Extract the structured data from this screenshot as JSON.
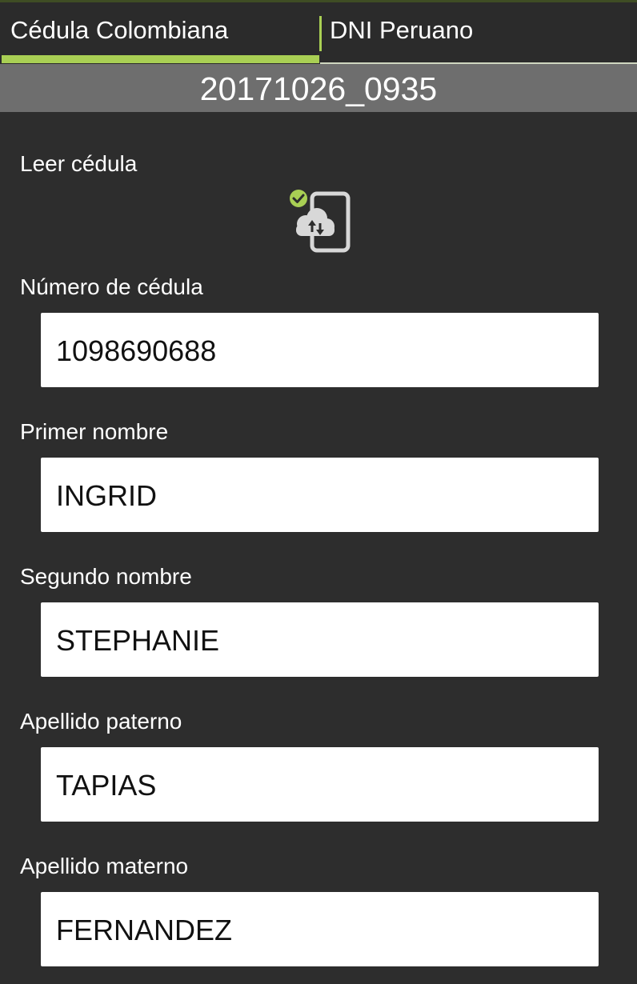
{
  "tabs": [
    {
      "label": "Cédula Colombiana",
      "selected": true
    },
    {
      "label": "DNI Peruano",
      "selected": false
    }
  ],
  "session": {
    "id": "20171026_0935"
  },
  "read": {
    "label": "Leer cédula",
    "icon": "phone-cloud-sync-icon",
    "status_icon": "check-circle-icon"
  },
  "fields": {
    "cedula": {
      "label": "Número de cédula",
      "value": "1098690688"
    },
    "primer_nombre": {
      "label": "Primer nombre",
      "value": "INGRID"
    },
    "segundo_nombre": {
      "label": "Segundo nombre",
      "value": "STEPHANIE"
    },
    "apellido_paterno": {
      "label": "Apellido paterno",
      "value": "TAPIAS"
    },
    "apellido_materno": {
      "label": "Apellido materno",
      "value": "FERNANDEZ"
    }
  },
  "colors": {
    "accent": "#a9cf54",
    "background": "#2d2d2d",
    "session_bar": "#6e6e6e",
    "field": "#ffffff"
  }
}
